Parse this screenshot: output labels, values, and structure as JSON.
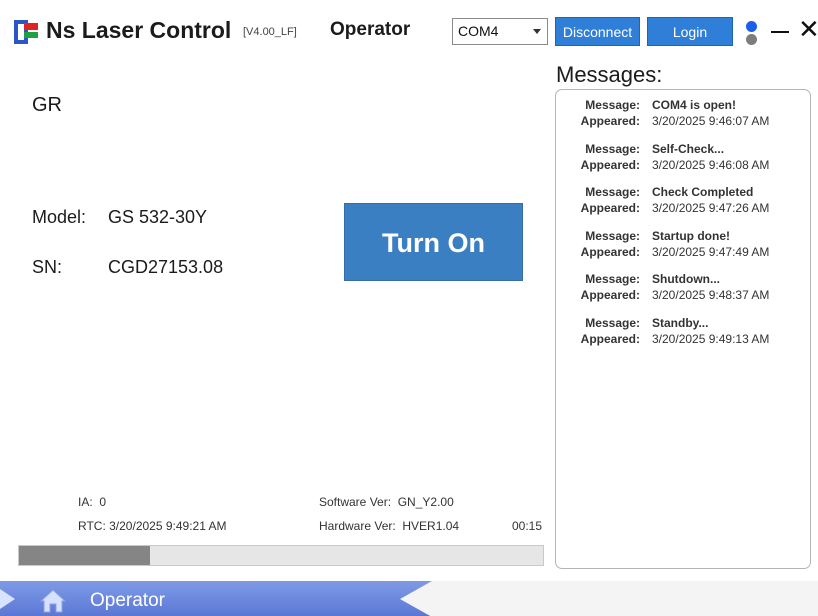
{
  "window": {
    "title": "Ns Laser Control",
    "version": "[V4.00_LF]",
    "role": "Operator",
    "com_port": "COM4",
    "disconnect_label": "Disconnect",
    "login_label": "Login",
    "status_colors": {
      "connected": "#1d5ee8",
      "idle": "#7d7d7d"
    }
  },
  "device": {
    "name": "GR",
    "model_label": "Model:",
    "model_value": "GS 532-30Y",
    "sn_label": "SN:",
    "sn_value": "CGD27153.08",
    "turn_on_label": "Turn On"
  },
  "status": {
    "ia_label": "IA:",
    "ia_value": "0",
    "rtc_label": "RTC:",
    "rtc_value": "3/20/2025 9:49:21 AM",
    "software_label": "Software Ver:",
    "software_value": "GN_Y2.00",
    "hardware_label": "Hardware Ver:",
    "hardware_value": "HVER1.04",
    "timer": "00:15",
    "progress_fraction": 0.25
  },
  "messages": {
    "title": "Messages:",
    "message_label": "Message:",
    "appeared_label": "Appeared:",
    "items": [
      {
        "message": "COM4 is open!",
        "appeared": "3/20/2025 9:46:07 AM"
      },
      {
        "message": "Self-Check...",
        "appeared": "3/20/2025 9:46:08 AM"
      },
      {
        "message": "Check Completed",
        "appeared": "3/20/2025 9:47:26 AM"
      },
      {
        "message": "Startup done!",
        "appeared": "3/20/2025 9:47:49 AM"
      },
      {
        "message": "Shutdown...",
        "appeared": "3/20/2025 9:48:37 AM"
      },
      {
        "message": "Standby...",
        "appeared": "3/20/2025 9:49:13 AM"
      }
    ]
  },
  "nav": {
    "current_label": "Operator",
    "icon": "home-icon"
  }
}
